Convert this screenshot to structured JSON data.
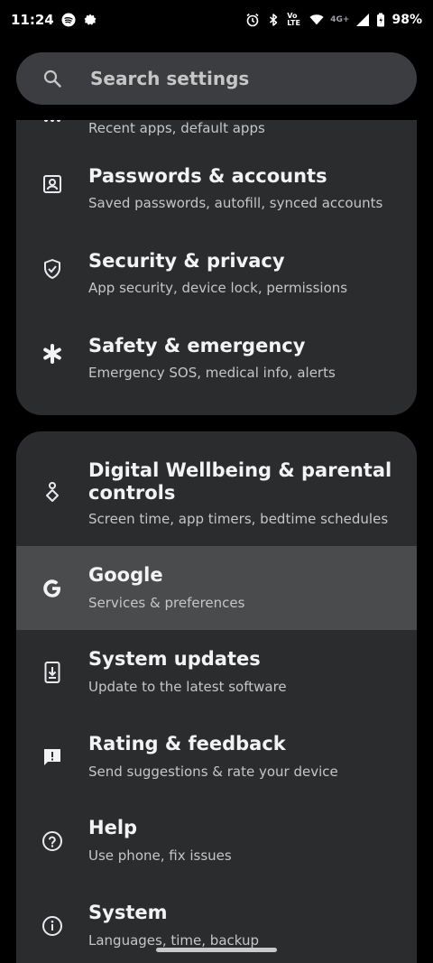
{
  "status_bar": {
    "time": "11:24",
    "volte": "Vo LTE",
    "network": "4G+",
    "battery": "98%"
  },
  "search": {
    "placeholder": "Search settings"
  },
  "card1": {
    "items": [
      {
        "title": "",
        "subtitle": "Recent apps, default apps",
        "icon": "apps-icon"
      },
      {
        "title": "Passwords & accounts",
        "subtitle": "Saved passwords, autofill, synced accounts",
        "icon": "account-box-icon"
      },
      {
        "title": "Security & privacy",
        "subtitle": "App security, device lock, permissions",
        "icon": "shield-check-icon"
      },
      {
        "title": "Safety & emergency",
        "subtitle": "Emergency SOS, medical info, alerts",
        "icon": "asterisk-icon"
      }
    ]
  },
  "card2": {
    "items": [
      {
        "title": "Digital Wellbeing & parental controls",
        "subtitle": "Screen time, app timers, bedtime schedules",
        "icon": "wellbeing-icon"
      },
      {
        "title": "Google",
        "subtitle": "Services & preferences",
        "icon": "google-icon"
      },
      {
        "title": "System updates",
        "subtitle": "Update to the latest software",
        "icon": "system-update-icon"
      },
      {
        "title": "Rating & feedback",
        "subtitle": "Send suggestions & rate your device",
        "icon": "feedback-icon"
      },
      {
        "title": "Help",
        "subtitle": "Use phone, fix issues",
        "icon": "help-icon"
      },
      {
        "title": "System",
        "subtitle": "Languages, time, backup",
        "icon": "info-icon"
      }
    ]
  },
  "colors": {
    "background": "#000000",
    "card": "#2b2c2e",
    "selected_row": "#4a4b4d",
    "search_bar": "#3c3d40"
  }
}
